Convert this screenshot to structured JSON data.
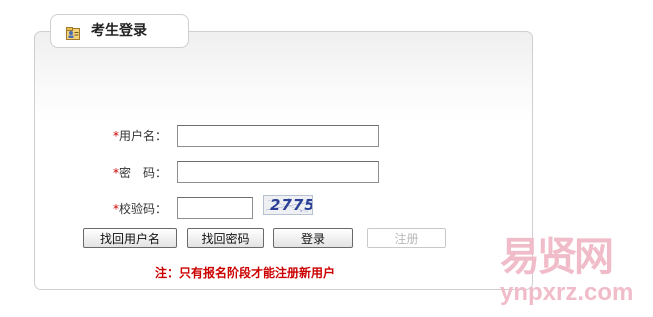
{
  "tab": {
    "title": "考生登录",
    "icon": "user-card-icon"
  },
  "form": {
    "required_mark": "*",
    "username_label": "用户名：",
    "password_label": "密　码：",
    "captcha_label": "校验码：",
    "username_value": "",
    "password_value": "",
    "captcha_value": "",
    "captcha_image_text": "2775"
  },
  "buttons": {
    "find_username": "找回用户名",
    "find_password": "找回密码",
    "login": "登录",
    "register": "注册"
  },
  "notice": "注：只有报名阶段才能注册新用户",
  "watermark": {
    "cn": "易贤网",
    "en": "ynpxrz.com"
  },
  "colors": {
    "required": "#cc0000",
    "notice": "#cc0000",
    "watermark": "#f1bcc9"
  }
}
